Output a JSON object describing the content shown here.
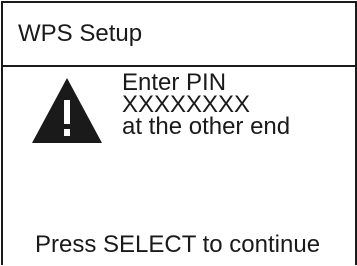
{
  "dialog": {
    "title": "WPS Setup",
    "icon": "warning-icon",
    "message": {
      "line1": "Enter PIN",
      "line2": "XXXXXXXX",
      "line3": "at the other end"
    },
    "footer": "Press SELECT to continue"
  },
  "colors": {
    "foreground": "#1a1a1a",
    "background": "#ffffff"
  }
}
